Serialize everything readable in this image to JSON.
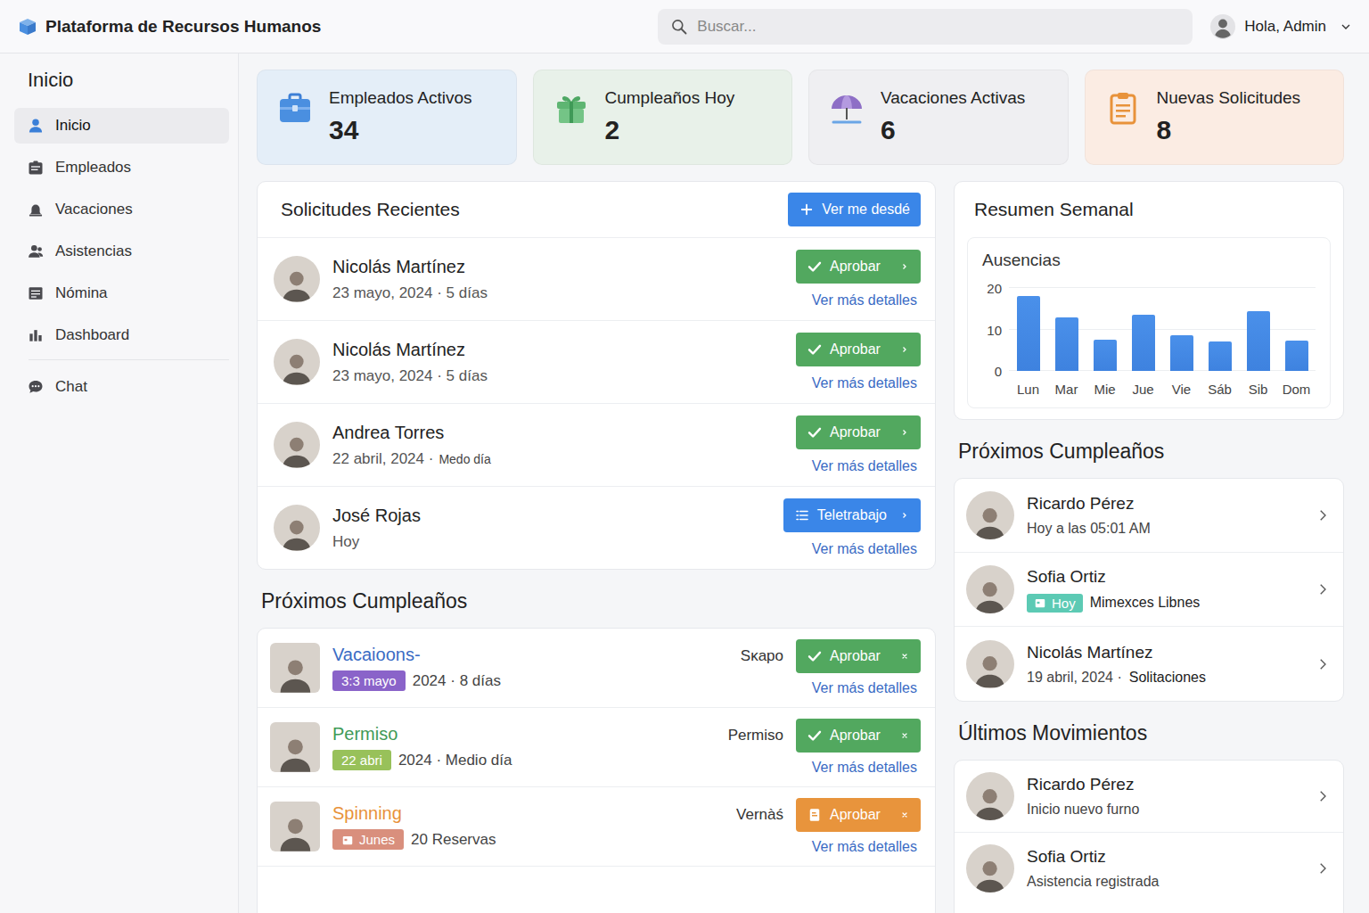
{
  "header": {
    "title": "Plataforma de Recursos Humanos",
    "search_placeholder": "Buscar...",
    "user": "Hola, Admin"
  },
  "sidebar": {
    "title": "Inicio",
    "groups": [
      {
        "items": [
          {
            "label": "Inicio",
            "selected": true
          },
          {
            "label": "Empleados",
            "selected": false
          },
          {
            "label": "Vacaciones",
            "selected": false
          },
          {
            "label": "Asistencias",
            "selected": false
          },
          {
            "label": "Nómina",
            "selected": false
          },
          {
            "label": "Dashboard",
            "selected": false
          }
        ]
      },
      {
        "items": [
          {
            "label": "Chat",
            "selected": false
          }
        ]
      }
    ]
  },
  "stats": [
    {
      "label": "Empleados Activos",
      "value": "34",
      "color": "#e4eef8"
    },
    {
      "label": "Cumpleaños Hoy",
      "value": "2",
      "color": "#e8f1e9"
    },
    {
      "label": "Vacaciones Activas",
      "value": "6",
      "color": "#efeff2"
    },
    {
      "label": "Nuevas Solicitudes",
      "value": "8",
      "color": "#fbece3"
    }
  ],
  "requests": {
    "title": "Solicitudes Recientes",
    "button": "Ver me desdé",
    "rows": [
      {
        "name": "Nicolás Martínez",
        "meta": [
          {
            "text": "23 mayo, 2024 · 5 días",
            "small": false
          }
        ],
        "action": {
          "label": "Aprobar",
          "kind": "approve"
        },
        "link": "Ver más detalles"
      },
      {
        "name": "Nicolás Martínez",
        "meta": [
          {
            "text": "23 mayo, 2024 · 5 días",
            "small": false
          }
        ],
        "action": {
          "label": "Aprobar",
          "kind": "approve"
        },
        "link": "Ver más detalles"
      },
      {
        "name": "Andrea Torres",
        "meta": [
          {
            "text": "22 abril, 2024 ·",
            "small": false
          },
          {
            "text": "Medo día",
            "small": true
          }
        ],
        "action": {
          "label": "Aprobar",
          "kind": "approve"
        },
        "link": "Ver más detalles"
      },
      {
        "name": "José Rojas",
        "meta": [
          {
            "text": "Hoy",
            "small": false
          }
        ],
        "action": {
          "label": "Teletrabajo",
          "kind": "remote"
        },
        "link": "Ver más detalles"
      }
    ]
  },
  "birthdays_left": {
    "title": "Próximos Cumpleaños",
    "rows": [
      {
        "title": "Vacaioons-",
        "title_color": "#3a6bc4",
        "tag": "3:3 mayo",
        "tag_color": "#8a63c9",
        "tag_icon": false,
        "meta": "2024 · 8 días",
        "label": "Sĸapo",
        "action": "Aprobar",
        "action_kind": "check",
        "action_color": "#52a85f",
        "link": "Ver más detalles"
      },
      {
        "title": "Permiso",
        "title_color": "#3f9a57",
        "tag": "22 abri",
        "tag_color": "#98c15a",
        "tag_icon": false,
        "meta": "2024 · Medio día",
        "label": "Permiso",
        "action": "Aprobar",
        "action_kind": "check",
        "action_color": "#52a85f",
        "link": "Ver más detalles"
      },
      {
        "title": "Spinning",
        "title_color": "#e8923a",
        "tag": "Junes",
        "tag_color": "#d98f7d",
        "tag_icon": true,
        "meta": "20 Reservas",
        "label": "Vernàś",
        "action": "Aprobar",
        "action_kind": "note",
        "action_color": "#e8943c",
        "link": "Ver más detalles"
      }
    ]
  },
  "summary": {
    "title": "Resumen Semanal",
    "chart": {
      "title": "Ausencias",
      "ticks": [
        "20",
        "10",
        "0"
      ],
      "labels": [
        "Lun",
        "Mar",
        "Mie",
        "Jue",
        "Vie",
        "Sáb",
        "Sib",
        "Dom"
      ],
      "values": [
        18,
        13,
        7.5,
        13.5,
        8.5,
        7,
        14.5,
        7.3
      ]
    }
  },
  "birthdays_right": {
    "title": "Próximos Cumpleaños",
    "rows": [
      {
        "name": "Ricardo Pérez",
        "parts": [
          {
            "text": "Hoy a las 05:01 AM",
            "kind": "plain"
          }
        ]
      },
      {
        "name": "Sofia Ortiz",
        "parts": [
          {
            "text": "Hoy",
            "kind": "tag"
          },
          {
            "text": "Mimexces Libnes",
            "kind": "strong"
          }
        ]
      },
      {
        "name": "Nicolás Martínez",
        "parts": [
          {
            "text": "19 abril, 2024 ·",
            "kind": "plain"
          },
          {
            "text": "Solitaciones",
            "kind": "strong"
          }
        ]
      }
    ]
  },
  "movements": {
    "title": "Últimos Movimientos",
    "rows": [
      {
        "name": "Ricardo Pérez",
        "sub": "Inicio nuevo furno"
      },
      {
        "name": "Sofia Ortiz",
        "sub": "Asistencia registrada"
      }
    ]
  }
}
